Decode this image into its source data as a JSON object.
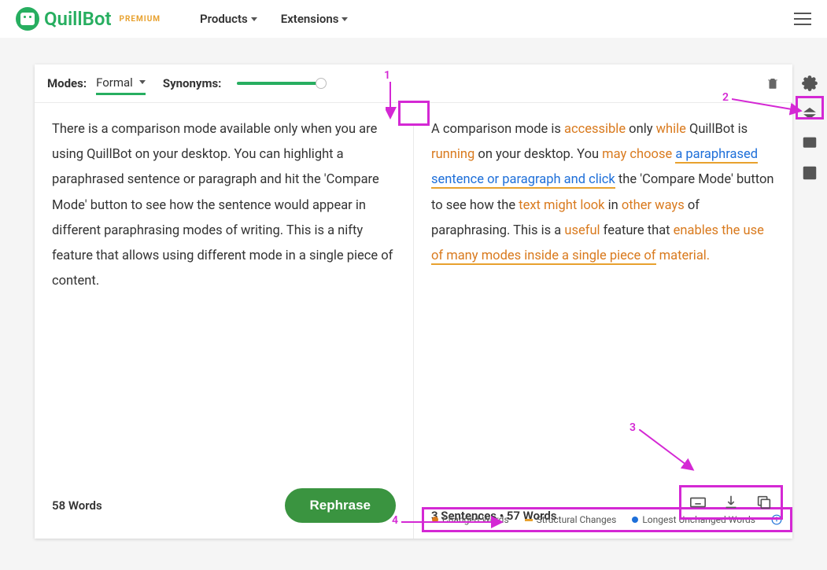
{
  "header": {
    "brand": "QuillBot",
    "premium": "PREMIUM",
    "nav": [
      "Products",
      "Extensions"
    ]
  },
  "toolbar": {
    "modes_label": "Modes:",
    "mode_selected": "Formal",
    "synonyms_label": "Synonyms:"
  },
  "left_pane": {
    "text": "There is a comparison mode available only when you are using QuillBot on your desktop. You can highlight a paraphrased sentence or paragraph and hit the 'Compare Mode' button to see how the sentence would appear in different paraphrasing modes of writing. This is a nifty feature that allows using different mode in a single piece of content.",
    "words": "58 Words",
    "button": "Rephrase"
  },
  "right_pane": {
    "segments": [
      {
        "t": "A comparison mode is ",
        "c": ""
      },
      {
        "t": "accessible",
        "c": "orange"
      },
      {
        "t": " only ",
        "c": ""
      },
      {
        "t": "while",
        "c": "orange"
      },
      {
        "t": " QuillBot is ",
        "c": ""
      },
      {
        "t": "running",
        "c": "orange"
      },
      {
        "t": " on your desktop. You ",
        "c": ""
      },
      {
        "t": "may choose",
        "c": "orange"
      },
      {
        "t": " ",
        "c": ""
      },
      {
        "t": "a paraphrased sentence or paragraph and click",
        "c": "blue-u"
      },
      {
        "t": " the 'Compare Mode' button to see how the ",
        "c": ""
      },
      {
        "t": "text might look",
        "c": "orange"
      },
      {
        "t": " in ",
        "c": ""
      },
      {
        "t": "other ways",
        "c": "orange"
      },
      {
        "t": " of paraphrasing. This is a ",
        "c": ""
      },
      {
        "t": "useful",
        "c": "orange"
      },
      {
        "t": " feature that ",
        "c": ""
      },
      {
        "t": "enables the use",
        "c": "orange"
      },
      {
        "t": " ",
        "c": ""
      },
      {
        "t": "of many modes inside a single piece of",
        "c": "orange-u"
      },
      {
        "t": " ",
        "c": ""
      },
      {
        "t": "material.",
        "c": "orange"
      }
    ],
    "stats": "3 Sentences  •  57 Words"
  },
  "legend": {
    "changed": "Changed Words",
    "structural": "Structural Changes",
    "longest": "Longest Unchanged Words"
  },
  "annotations": {
    "a1": "1",
    "a2": "2",
    "a3": "3",
    "a4": "4"
  }
}
